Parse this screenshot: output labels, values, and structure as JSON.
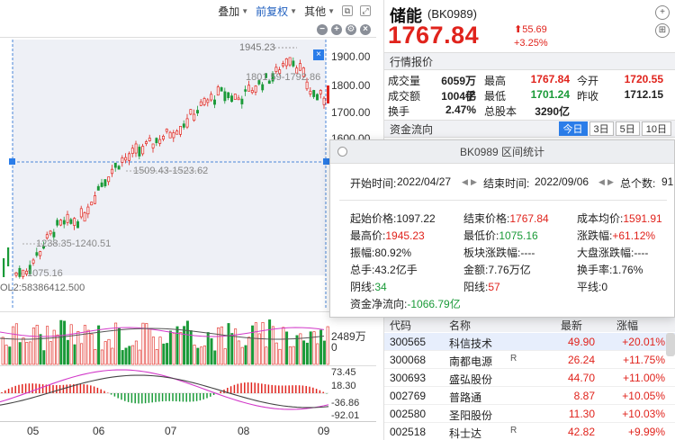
{
  "toolbar": {
    "overlay_label": "叠加",
    "adjust_label": "前复权",
    "other_label": "其他"
  },
  "chart": {
    "price_ticks": [
      "1900.00",
      "1800.00",
      "1700.00",
      "1600.00"
    ],
    "annotations": {
      "high": "1945.23",
      "mid_high": "1801.59-1792.86",
      "mid": "1509.43-1523.62",
      "low_mid": "1238.35-1240.51",
      "low": "1075.16"
    },
    "vol_label": "OL2:58386412.500",
    "vol_tick": "2489万",
    "vol_tick_zero": "0",
    "macd_ticks": [
      "73.45",
      "18.30",
      "-36.86",
      "-92.01"
    ],
    "x_labels": [
      "05",
      "06",
      "07",
      "08",
      "09"
    ],
    "colors": {
      "up": "#e0231c",
      "down": "#1a9a38",
      "selection": "#eef0f6",
      "line_white": "#888888",
      "line_magenta": "#d23ac9"
    }
  },
  "quote": {
    "name": "储能",
    "code": "(BK0989)",
    "price": "1767.84",
    "change": "55.69",
    "change_pct": "+3.25%",
    "section_quote": "行情报价",
    "rows": [
      {
        "k1": "成交量",
        "v1": "6059万手",
        "k2": "最高",
        "v2": "1767.84",
        "k3": "今开",
        "v3": "1720.55"
      },
      {
        "k1": "成交额",
        "v1": "1004亿",
        "k2": "最低",
        "v2": "1701.24",
        "k3": "昨收",
        "v3": "1712.15"
      },
      {
        "k1": "换手",
        "v1": "2.47%",
        "k2": "总股本",
        "v2": "3290亿",
        "k3": "",
        "v3": ""
      }
    ],
    "section_fund": "资金流向",
    "fund_tabs": [
      "今日",
      "3日",
      "5日",
      "10日"
    ]
  },
  "table": {
    "headers": [
      "代码",
      "名称",
      "最新",
      "涨幅"
    ],
    "rows": [
      {
        "code": "300565",
        "name": "科信技术",
        "flag": "",
        "price": "49.90",
        "chg": "+20.01%"
      },
      {
        "code": "300068",
        "name": "南都电源",
        "flag": "R",
        "price": "26.24",
        "chg": "+11.75%"
      },
      {
        "code": "300693",
        "name": "盛弘股份",
        "flag": "",
        "price": "44.70",
        "chg": "+11.00%"
      },
      {
        "code": "002769",
        "name": "普路通",
        "flag": "",
        "price": "8.87",
        "chg": "+10.05%"
      },
      {
        "code": "002580",
        "name": "圣阳股份",
        "flag": "",
        "price": "11.30",
        "chg": "+10.03%"
      },
      {
        "code": "002518",
        "name": "科士达",
        "flag": "R",
        "price": "42.82",
        "chg": "+9.99%"
      }
    ]
  },
  "popup": {
    "title": "BK0989 区间统计",
    "start_label": "开始时间:",
    "start_value": "2022/04/27",
    "end_label": "结束时间:",
    "end_value": "2022/09/06",
    "count_label": "总个数:",
    "count_value": "91",
    "stats": [
      {
        "k": "起始价格:",
        "v": "1097.22",
        "color": "black"
      },
      {
        "k": "结束价格:",
        "v": "1767.84",
        "color": "red"
      },
      {
        "k": "成本均价:",
        "v": "1591.91",
        "color": "red"
      },
      {
        "k": "最高价:",
        "v": "1945.23",
        "color": "red"
      },
      {
        "k": "最低价:",
        "v": "1075.16",
        "color": "green"
      },
      {
        "k": "涨跌幅:",
        "v": "+61.12%",
        "color": "red"
      },
      {
        "k": "振幅:",
        "v": "80.92%",
        "color": "black"
      },
      {
        "k": "板块涨跌幅:",
        "v": "----",
        "color": "black"
      },
      {
        "k": "大盘涨跌幅:",
        "v": "----",
        "color": "black"
      },
      {
        "k": "总手:",
        "v": "43.2亿手",
        "color": "black"
      },
      {
        "k": "金额:",
        "v": "7.76万亿",
        "color": "black"
      },
      {
        "k": "换手率:",
        "v": "1.76%",
        "color": "black"
      },
      {
        "k": "阴线:",
        "v": "34",
        "color": "green"
      },
      {
        "k": "阳线:",
        "v": "57",
        "color": "red"
      },
      {
        "k": "平线:",
        "v": "0",
        "color": "black"
      },
      {
        "k": "资金净流向:",
        "v": "-1066.79亿",
        "color": "green"
      }
    ]
  }
}
